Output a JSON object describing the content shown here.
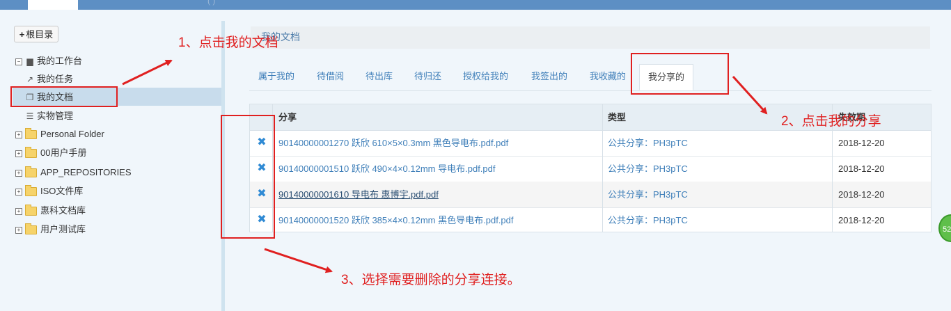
{
  "topbar": {
    "faint_text": "(   )"
  },
  "sidebar": {
    "root_button": "根目录",
    "workbench": "我的工作台",
    "items": [
      {
        "label": "我的任务",
        "icon": "external-link-icon"
      },
      {
        "label": "我的文档",
        "icon": "copy-icon"
      },
      {
        "label": "实物管理",
        "icon": "list-icon"
      }
    ],
    "folders": [
      "Personal Folder",
      "00用户手册",
      "APP_REPOSITORIES",
      "ISO文件库",
      "惠科文档库",
      "用户测试库"
    ]
  },
  "breadcrumb": "我的文档",
  "tabs": [
    "属于我的",
    "待借阅",
    "待出库",
    "待归还",
    "授权给我的",
    "我签出的",
    "我收藏的",
    "我分享的"
  ],
  "active_tab": "我分享的",
  "table": {
    "headers": {
      "share": "分享",
      "type": "类型",
      "date": "失效期"
    },
    "rows": [
      {
        "name": "90140000001270 跃欣 610×5×0.3mm 黑色导电布.pdf.pdf",
        "type": "公共分享：PH3pTC",
        "date": "2018-12-20"
      },
      {
        "name": "90140000001510 跃欣 490×4×0.12mm 导电布.pdf.pdf",
        "type": "公共分享：PH3pTC",
        "date": "2018-12-20"
      },
      {
        "name": "90140000001610 导电布 惠博宇.pdf.pdf",
        "type": "公共分享：PH3pTC",
        "date": "2018-12-20"
      },
      {
        "name": "90140000001520 跃欣 385×4×0.12mm 黑色导电布.pdf.pdf",
        "type": "公共分享：PH3pTC",
        "date": "2018-12-20"
      }
    ]
  },
  "annotations": {
    "step1": "1、点击我的文档",
    "step2": "2、点击我的分享",
    "step3": "3、选择需要删除的分享连接。",
    "color": "#e02020"
  },
  "badge": "52"
}
